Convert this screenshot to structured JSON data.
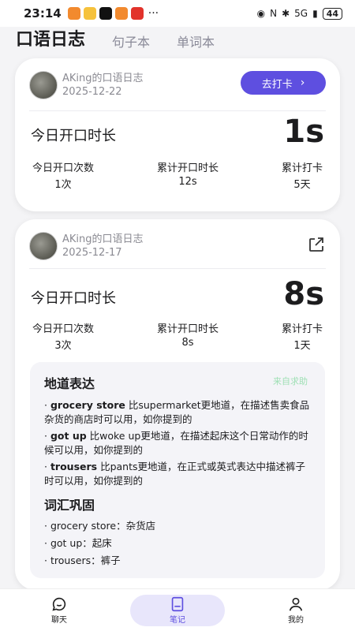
{
  "status": {
    "time": "23:14",
    "dots": "···",
    "signal": "5G",
    "battery": "44"
  },
  "header": {
    "tabs": [
      {
        "label": "口语日志"
      },
      {
        "label": "句子本"
      },
      {
        "label": "单词本"
      }
    ]
  },
  "cards": [
    {
      "user": "AKing的口语日志",
      "date": "2025-12-22",
      "action": "去打卡",
      "today_label": "今日开口时长",
      "today_value": "1s",
      "stats": [
        {
          "label": "今日开口次数",
          "value": "1次"
        },
        {
          "label": "累计开口时长",
          "value": "12s"
        },
        {
          "label": "累计打卡",
          "value": "5天"
        }
      ]
    },
    {
      "user": "AKing的口语日志",
      "date": "2025-12-17",
      "today_label": "今日开口时长",
      "today_value": "8s",
      "stats": [
        {
          "label": "今日开口次数",
          "value": "3次"
        },
        {
          "label": "累计开口时长",
          "value": "8s"
        },
        {
          "label": "累计打卡",
          "value": "1天"
        }
      ],
      "tips": {
        "title": "地道表达",
        "source": "来自求助",
        "items": [
          {
            "term": "grocery store",
            "text": " 比supermarket更地道，在描述售卖食品杂货的商店时可以用，如你提到的"
          },
          {
            "term": "got up",
            "text": " 比woke up更地道，在描述起床这个日常动作的时候可以用，如你提到的"
          },
          {
            "term": "trousers",
            "text": " 比pants更地道，在正式或英式表达中描述裤子时可以用，如你提到的"
          }
        ],
        "vocab_title": "词汇巩固",
        "vocab": [
          "grocery store：杂货店",
          "got up：起床",
          "trousers：裤子"
        ]
      }
    }
  ],
  "nav": [
    {
      "label": "聊天"
    },
    {
      "label": "笔记"
    },
    {
      "label": "我的"
    }
  ],
  "colors": {
    "accent": "#5e4fe0",
    "source_green": "#9fe0b5"
  }
}
